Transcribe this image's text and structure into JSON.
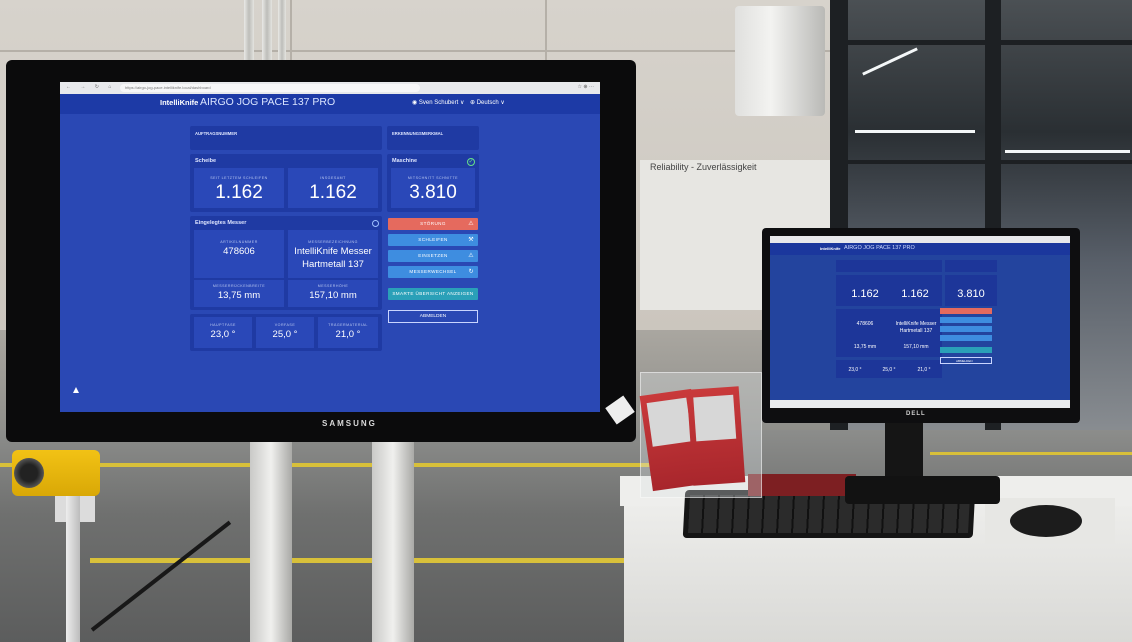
{
  "left_screen": {
    "browser": {
      "url": "https://airgo-jog-pace.intelliknife.local/dashboard",
      "controls": "← → ↻ ⌂",
      "right_icons": "☆ ⊕ ⋯"
    },
    "header": {
      "logo": "IntelliKnife",
      "title": "AIRGO JOG PACE 137 PRO",
      "user": "Sven Schubert",
      "language": "Deutsch",
      "chevron": "∨"
    },
    "auftragsnummer": {
      "title": "AUFTRAGSNUMMER"
    },
    "erkennungsmerkmal": {
      "title": "ERKENNUNGSMERKMAL"
    },
    "scheibe": {
      "title": "Scheibe",
      "seit_letztem_label": "SEIT LETZTEM SCHLEIFEN",
      "seit_letztem_value": "1.162",
      "insgesamt_label": "INSGESAMT",
      "insgesamt_value": "1.162"
    },
    "maschine": {
      "title": "Maschine",
      "schnitte_label": "MITSCHNITT SCHNITTE",
      "schnitte_value": "3.810",
      "check": "✓"
    },
    "messer": {
      "title": "Eingelegtes Messer",
      "artikel_label": "ARTIKELNUMMER",
      "artikel_value": "478606",
      "bezeichnung_label": "MESSERBEZEICHNUNG",
      "bezeichnung_line1": "IntelliKnife Messer",
      "bezeichnung_line2": "Hartmetall 137",
      "rueckenbreite_label": "MESSERRÜCKENBREITE",
      "rueckenbreite_value": "13,75 mm",
      "hoehe_label": "MESSERHÖHE",
      "hoehe_value": "157,10 mm"
    },
    "winkel": {
      "hauptfase_label": "HAUPTFASE",
      "hauptfase_value": "23,0 °",
      "vorfase_label": "VORFASE",
      "vorfase_value": "25,0 °",
      "traeger_label": "TRÄGERMATERIAL",
      "traeger_value": "21,0 °"
    },
    "actions": {
      "stoerung": "STÖRUNG",
      "stoerung_icon": "⚠",
      "schleifen": "SCHLEIFEN",
      "schleifen_icon": "⚒",
      "einsetzen": "EINSETZEN",
      "einsetzen_icon": "⚠",
      "messerwechsel": "MESSERWECHSEL",
      "messerwechsel_icon": "↻",
      "uebersicht": "SMARTE ÜBERSICHT ANZEIGEN",
      "abmelden": "ABMELDEN"
    },
    "monitor_brand": "SAMSUNG"
  },
  "right_screen": {
    "title": "AIRGO JOG PACE 137 PRO",
    "logo": "IntelliKnife",
    "seit_letztem_value": "1.162",
    "insgesamt_value": "1.162",
    "schnitte_value": "3.810",
    "artikel_value": "478606",
    "bezeichnung_line1": "IntelliKnife Messer",
    "bezeichnung_line2": "Hartmetall 137",
    "rueckenbreite_value": "13,75 mm",
    "hoehe_value": "157,10 mm",
    "hauptfase_value": "23,0 °",
    "vorfase_value": "25,0 °",
    "traeger_value": "21,0 °",
    "abmelden": "ABMELDEN",
    "monitor_brand": "DELL"
  },
  "environment": {
    "sign_title": "Reliability - Zuverlässigkeit"
  },
  "colors": {
    "screen_bg": "#2a48b4",
    "card_bg": "#1f3aa3",
    "danger": "#e56a5e",
    "primary": "#3e8de0",
    "teal": "#2aa0b8"
  }
}
